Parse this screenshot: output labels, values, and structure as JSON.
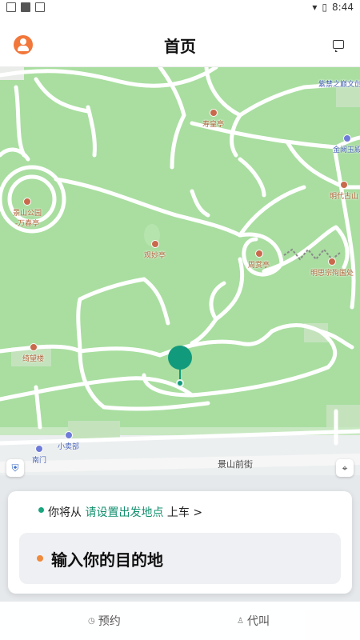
{
  "status_bar": {
    "time": "8:44"
  },
  "header": {
    "title": "首页"
  },
  "map": {
    "pois": [
      {
        "label": "紫禁之巅文创",
        "type": "blue"
      },
      {
        "label": "寿皇亭",
        "type": "park"
      },
      {
        "label": "金阙玉殿",
        "type": "blue"
      },
      {
        "label": "景山公园\n-万春亭",
        "type": "park"
      },
      {
        "label": "明代古山",
        "type": "park"
      },
      {
        "label": "观妙亭",
        "type": "park"
      },
      {
        "label": "周赏亭",
        "type": "park"
      },
      {
        "label": "明思宗殉国处",
        "type": "park"
      },
      {
        "label": "绮望楼",
        "type": "park"
      },
      {
        "label": "小卖部",
        "type": "blue"
      },
      {
        "label": "南门",
        "type": "blue"
      }
    ],
    "road": "景山前街"
  },
  "booking": {
    "from_prefix": "你将从",
    "from_link": "请设置出发地点",
    "from_suffix": "上车 >",
    "destination_placeholder": "输入你的目的地"
  },
  "tabs": [
    {
      "label": "预约",
      "icon": "clock-icon"
    },
    {
      "label": "代叫",
      "icon": "person-icon"
    }
  ],
  "colors": {
    "accent": "#129a7c",
    "orange": "#f08a3c",
    "map_green": "#a9dea0"
  }
}
